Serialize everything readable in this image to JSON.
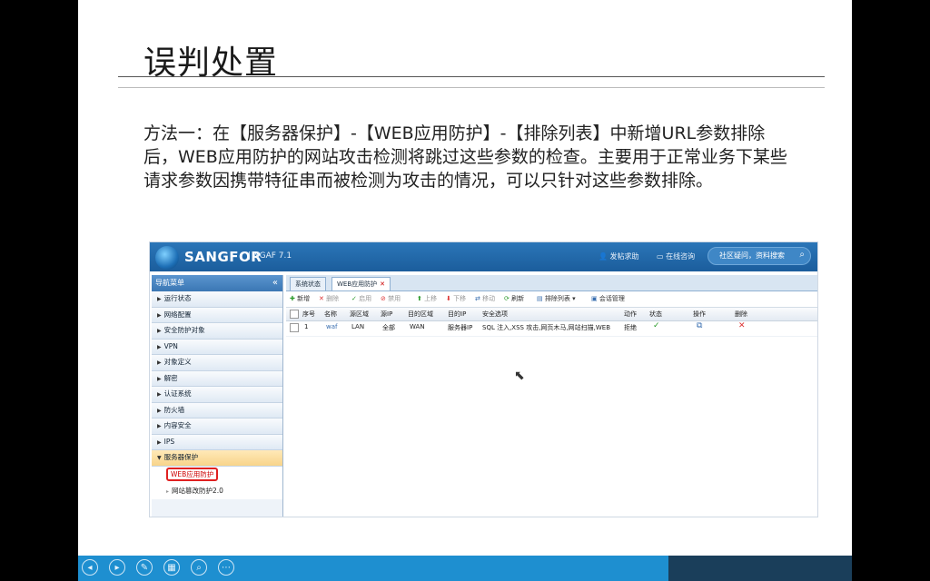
{
  "slide": {
    "title": "误判处置",
    "paragraph": "方法一：在【服务器保护】-【WEB应用防护】-【排除列表】中新增URL参数排除后，WEB应用防护的网站攻击检测将跳过这些参数的检查。主要用于正常业务下某些请求参数因携带特征串而被检测为攻击的情况，可以只针对这些参数排除。"
  },
  "app": {
    "logo": "SANGFOR",
    "product": "| NGAF 7.1",
    "help": "发帖求助",
    "consult": "在线咨询",
    "search_placeholder": "社区疑问，资料搜索"
  },
  "nav": {
    "header": "导航菜单",
    "collapse": "«",
    "items": [
      "运行状态",
      "网络配置",
      "安全防护对象",
      "VPN",
      "对象定义",
      "解密",
      "认证系统",
      "防火墙",
      "内容安全",
      "IPS",
      "服务器保护"
    ],
    "sub_items": [
      "WEB应用防护",
      "网站篡改防护2.0"
    ]
  },
  "tabs": [
    "系统状态",
    "WEB应用防护"
  ],
  "toolbar": {
    "add": "新增",
    "delete": "删除",
    "enable": "启用",
    "disable": "禁用",
    "up": "上移",
    "down": "下移",
    "move": "移动",
    "refresh": "刷新",
    "exclusion": "排除列表",
    "session": "会话管理"
  },
  "table": {
    "headers": [
      "序号",
      "名称",
      "源区域",
      "源IP",
      "目的区域",
      "目的IP",
      "安全选项",
      "动作",
      "状态",
      "操作",
      "删除"
    ],
    "rows": [
      {
        "no": "1",
        "name": "waf",
        "src_zone": "LAN",
        "src_ip": "全部",
        "dst_zone": "WAN",
        "dst_ip": "服务器IP",
        "options": "SQL 注入,XSS 攻击,网页木马,网站扫描,WEB",
        "action": "拒绝",
        "status": "✓",
        "op": "⧉",
        "del": "✕"
      }
    ]
  },
  "colors": {
    "brand_blue": "#1b5d9c",
    "bottom_bar": "#1e8fd0"
  },
  "bottom_controls": [
    "prev-icon",
    "next-icon",
    "pen-icon",
    "pages-icon",
    "zoom-icon",
    "more-icon"
  ]
}
